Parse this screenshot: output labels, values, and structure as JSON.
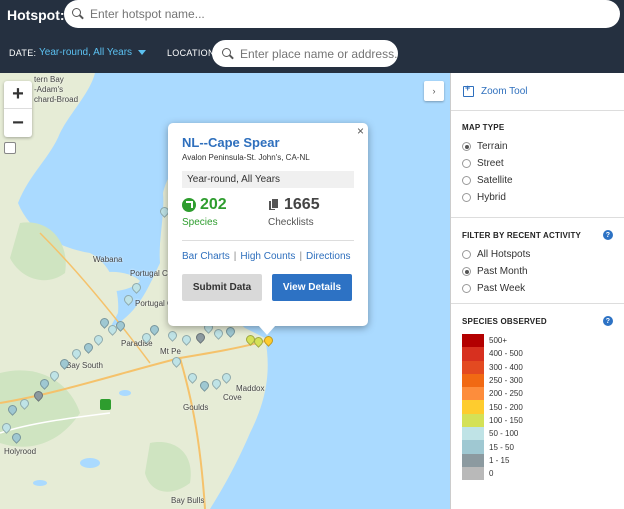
{
  "header": {
    "hotspot_label": "Hotspot:",
    "hotspot_placeholder": "Enter hotspot name...",
    "date_label": "DATE:",
    "date_value": "Year-round, All Years",
    "location_label": "LOCATION:",
    "location_placeholder": "Enter place name or address..."
  },
  "map": {
    "zoom_in": "+",
    "zoom_out": "−",
    "collapse": "›",
    "labels": [
      "tern Bay",
      "-Adam's",
      "chard-Broad",
      "Wabana",
      "Portugal Cove-St. Philip's",
      "Portugal Cove",
      "Paradise",
      "Mt Pe",
      "Bay South",
      "Goulds",
      "Maddox",
      "Cove",
      "Holyrood",
      "Bay Bulls"
    ]
  },
  "popup": {
    "close": "×",
    "title": "NL--Cape Spear",
    "subtitle": "Avalon Peninsula-St. John's, CA-NL",
    "date": "Year-round, All Years",
    "species_count": "202",
    "species_label": "Species",
    "checklists_count": "1665",
    "checklists_label": "Checklists",
    "links": [
      "Bar Charts",
      "High Counts",
      "Directions"
    ],
    "submit_label": "Submit Data",
    "view_label": "View Details"
  },
  "sidebar": {
    "zoom_tool": "Zoom Tool",
    "map_type": {
      "title": "MAP TYPE",
      "options": [
        "Terrain",
        "Street",
        "Satellite",
        "Hybrid"
      ],
      "selected": "Terrain"
    },
    "filter": {
      "title": "FILTER BY RECENT ACTIVITY",
      "options": [
        "All Hotspots",
        "Past Month",
        "Past Week"
      ],
      "selected": "Past Month"
    },
    "species_observed": {
      "title": "SPECIES OBSERVED",
      "ranges": [
        {
          "label": "500+",
          "color": "#b30000"
        },
        {
          "label": "400 - 500",
          "color": "#d7301f"
        },
        {
          "label": "300 - 400",
          "color": "#e34a21"
        },
        {
          "label": "250 - 300",
          "color": "#f16913"
        },
        {
          "label": "200 - 250",
          "color": "#fd8d3c"
        },
        {
          "label": "150 - 200",
          "color": "#fecc2e"
        },
        {
          "label": "100 - 150",
          "color": "#d4e157"
        },
        {
          "label": "50 - 100",
          "color": "#bfe3e6"
        },
        {
          "label": "15 - 50",
          "color": "#9fc8d2"
        },
        {
          "label": "1 - 15",
          "color": "#8c9aa0"
        },
        {
          "label": "0",
          "color": "#b9b9b9"
        }
      ]
    },
    "help": "?"
  }
}
